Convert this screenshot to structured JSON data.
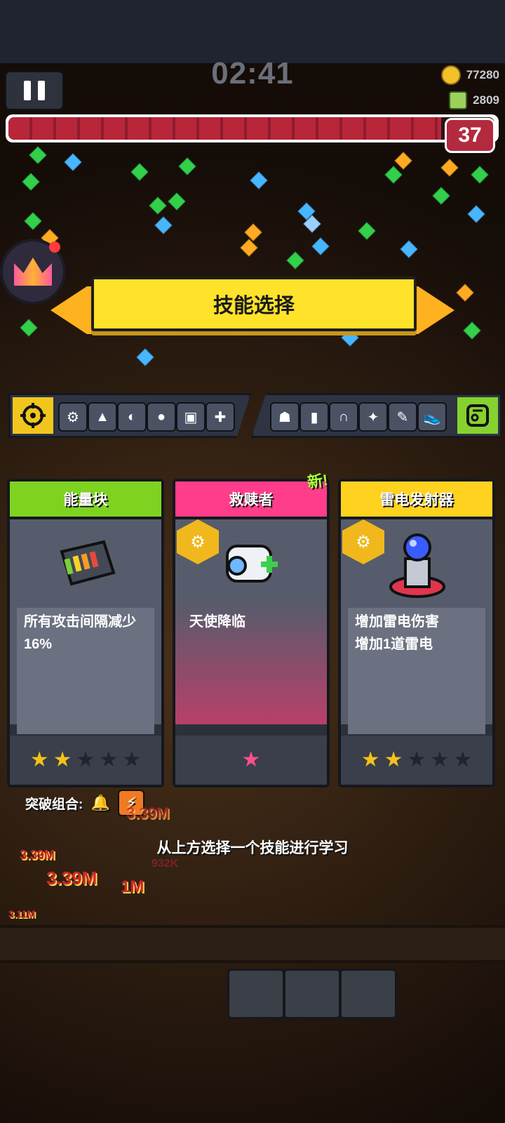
{
  "hud": {
    "timer": "02:41",
    "coins": "77280",
    "kills": "2809",
    "level": "37",
    "xp_progress": 0.89
  },
  "banner": {
    "title": "技能选择"
  },
  "equipment": {
    "left_slots": [
      "⚙",
      "▲",
      "◐",
      "●",
      "▣",
      "✚"
    ],
    "right_slots": [
      "☗",
      "▮",
      "∩",
      "✦",
      "✎",
      "👟"
    ]
  },
  "cards": [
    {
      "name": "能量块",
      "description": "所有攻击间隔减少16%",
      "stars_filled": 2,
      "stars_total": 5,
      "header_color": "#7ed321"
    },
    {
      "name": "救赎者",
      "description": "天使降临",
      "stars_filled": 1,
      "stars_total": 1,
      "header_color": "#ff3d8a",
      "new_tag": "新!"
    },
    {
      "name": "雷电发射器",
      "description_line1": "增加雷电伤害",
      "description_line2": "增加1道雷电",
      "stars_filled": 2,
      "stars_total": 5,
      "header_color": "#ffd21f"
    }
  ],
  "combo": {
    "label": "突破组合:"
  },
  "hint": "从上方选择一个技能进行学习",
  "damage_numbers": [
    "3.39M",
    "3.39M",
    "932K",
    "1M",
    "3.39M",
    "3.11M"
  ]
}
